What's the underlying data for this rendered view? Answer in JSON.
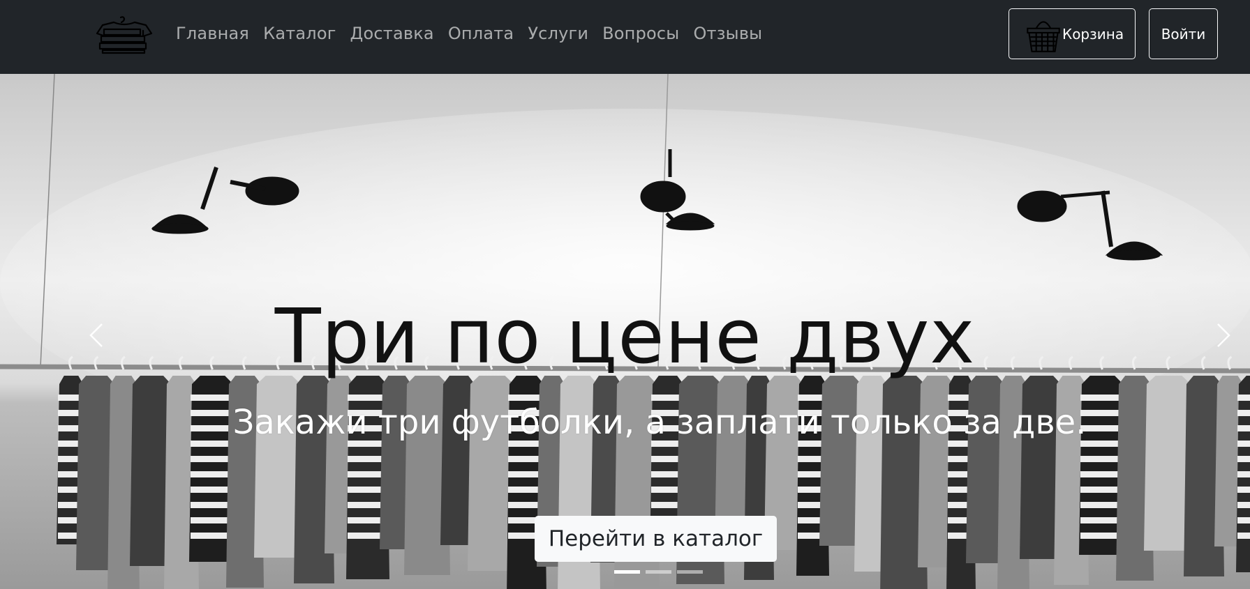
{
  "nav": {
    "logo": "tshirt-stack-logo",
    "links": [
      "Главная",
      "Каталог",
      "Доставка",
      "Оплата",
      "Услуги",
      "Вопросы",
      "Отзывы"
    ],
    "cart_label": "Корзина",
    "login_label": "Войти"
  },
  "hero": {
    "title": "Три по цене двух",
    "text": "Закажи три футболки, а заплати только за две.",
    "button_label": "Перейти в каталог",
    "slides_count": 3,
    "active_slide": 1
  },
  "colors": {
    "navbar_bg": "#212529",
    "nav_link": "rgba(255,255,255,0.62)",
    "button_light": "#f8f9fa"
  }
}
